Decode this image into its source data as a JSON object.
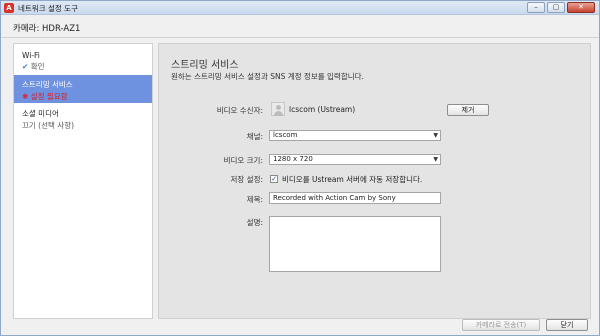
{
  "window": {
    "title": "네트워크 설정 도구",
    "app_icon_glyph": "A",
    "minimize_glyph": "–",
    "maximize_glyph": "▢",
    "close_glyph": "✕"
  },
  "camera": {
    "label": "카메라: HDR-AZ1"
  },
  "sidebar": {
    "items": [
      {
        "title": "Wi-Fi",
        "status_icon": "✔",
        "status": "확인"
      },
      {
        "title": "스트리밍 서비스",
        "status_icon": "✱",
        "status": "설정 필요함"
      },
      {
        "title": "소셜 미디어",
        "status": "끄기 (선택 사항)"
      }
    ]
  },
  "main": {
    "title": "스트리밍 서비스",
    "description": "원하는 스트리밍 서비스 설정과 SNS 계정 정보를 입력합니다.",
    "receiver": {
      "label": "비디오 수신자:",
      "account": "lcscom (Ustream)",
      "remove_label": "제거"
    },
    "channel": {
      "label": "채널:",
      "value": "lcscom"
    },
    "video_size": {
      "label": "비디오 크기:",
      "value": "1280 x 720"
    },
    "save_setting": {
      "label": "저장 설정:",
      "checkbox_glyph": "✓",
      "checkbox_label": "비디오를 Ustream 서버에 자동 저장합니다."
    },
    "title_field": {
      "label": "제목:",
      "value": "Recorded with Action Cam by Sony"
    },
    "description_field": {
      "label": "설명:",
      "value": ""
    }
  },
  "footer": {
    "transfer_label": "카메라로 전송(T)",
    "close_label": "닫기"
  },
  "colors": {
    "selected_item": "#6f92e0",
    "warning": "#d8202a",
    "ok": "#3a7fd6"
  }
}
